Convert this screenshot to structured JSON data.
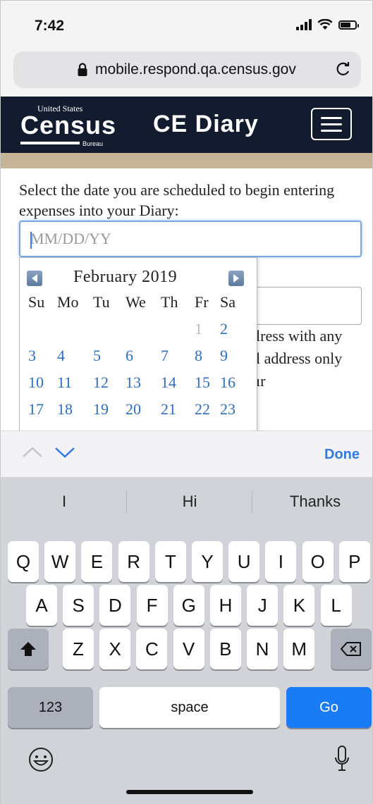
{
  "status_bar": {
    "time": "7:42"
  },
  "browser": {
    "url": "mobile.respond.qa.census.gov"
  },
  "header": {
    "logo_small": "United States",
    "logo_main": "Census",
    "logo_bureau": "Bureau",
    "title": "CE Diary"
  },
  "form": {
    "prompt": "Select the date you are scheduled to begin entering expenses into your Diary:",
    "date_placeholder": "MM/DD/YY",
    "date_value": "",
    "info_line1": "lress with any",
    "info_line2": "l address only",
    "info_line3": "ır"
  },
  "calendar": {
    "title": "February 2019",
    "weekdays": [
      "Su",
      "Mo",
      "Tu",
      "We",
      "Th",
      "Fr",
      "Sa"
    ],
    "weeks": [
      [
        "",
        "",
        "",
        "",
        "",
        "1",
        "2"
      ],
      [
        "3",
        "4",
        "5",
        "6",
        "7",
        "8",
        "9"
      ],
      [
        "10",
        "11",
        "12",
        "13",
        "14",
        "15",
        "16"
      ],
      [
        "17",
        "18",
        "19",
        "20",
        "21",
        "22",
        "23"
      ]
    ],
    "disabled_days": [
      "1"
    ]
  },
  "keyboard": {
    "done_label": "Done",
    "suggestions": [
      "I",
      "Hi",
      "Thanks"
    ],
    "row1": [
      "Q",
      "W",
      "E",
      "R",
      "T",
      "Y",
      "U",
      "I",
      "O",
      "P"
    ],
    "row2": [
      "A",
      "S",
      "D",
      "F",
      "G",
      "H",
      "J",
      "K",
      "L"
    ],
    "row3": [
      "Z",
      "X",
      "C",
      "V",
      "B",
      "N",
      "M"
    ],
    "numbers_label": "123",
    "space_label": "space",
    "go_label": "Go"
  },
  "colors": {
    "header_bg": "#131c2e",
    "accent_band": "#c5b498",
    "link_blue": "#2f6dbd",
    "go_blue": "#1a7cf5"
  }
}
